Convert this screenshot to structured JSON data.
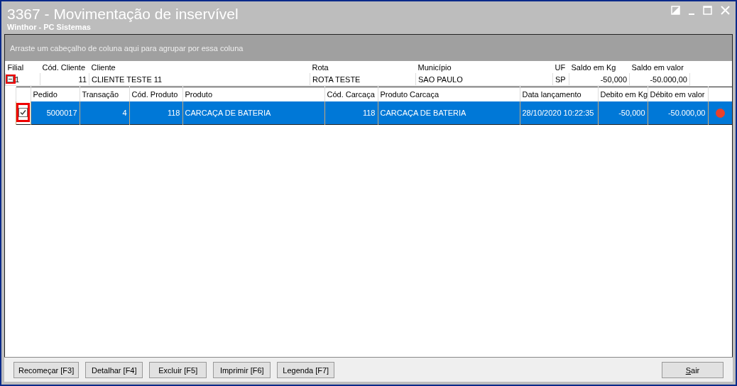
{
  "window": {
    "title": "3367 - Movimentação de inservível",
    "subtitle": "Winthor - PC Sistemas"
  },
  "group_panel": {
    "hint": "Arraste um cabeçalho de coluna aqui para agrupar por essa coluna"
  },
  "master": {
    "columns": [
      "Filial",
      "Cód. Cliente",
      "Cliente",
      "Rota",
      "Município",
      "UF",
      "Saldo em Kg",
      "Saldo em valor"
    ],
    "rows": [
      {
        "expanded": true,
        "highlighted": true,
        "cells": [
          "1",
          "11",
          "CLIENTE TESTE 11",
          "ROTA TESTE",
          "SAO PAULO",
          "SP",
          "-50,000",
          "-50.000,00"
        ]
      }
    ]
  },
  "detail": {
    "columns": [
      "Pedido",
      "Transação",
      "Cód. Produto",
      "Produto",
      "Cód. Carcaça",
      "Produto Carcaça",
      "Data lançamento",
      "Debito em Kg",
      "Débito em valor"
    ],
    "rows": [
      {
        "selected": true,
        "checked": true,
        "highlighted": true,
        "color": "#e8402a",
        "cells": [
          "5000017",
          "4",
          "118",
          "CARCAÇA DE BATERIA",
          "118",
          "CARCAÇA DE BATERIA",
          "28/10/2020 10:22:35",
          "-50,000",
          "-50.000,00"
        ]
      }
    ]
  },
  "buttons": [
    {
      "label": "Recomeçar [F3]",
      "underline_first": false
    },
    {
      "label": "Detalhar [F4]",
      "underline_first": false
    },
    {
      "label": "Excluir [F5]",
      "underline_first": false
    },
    {
      "label": "Imprimir [F6]",
      "underline_first": false
    },
    {
      "label": "Legenda [F7]",
      "underline_first": false
    },
    {
      "label": "Sair",
      "underline_first": true
    }
  ]
}
